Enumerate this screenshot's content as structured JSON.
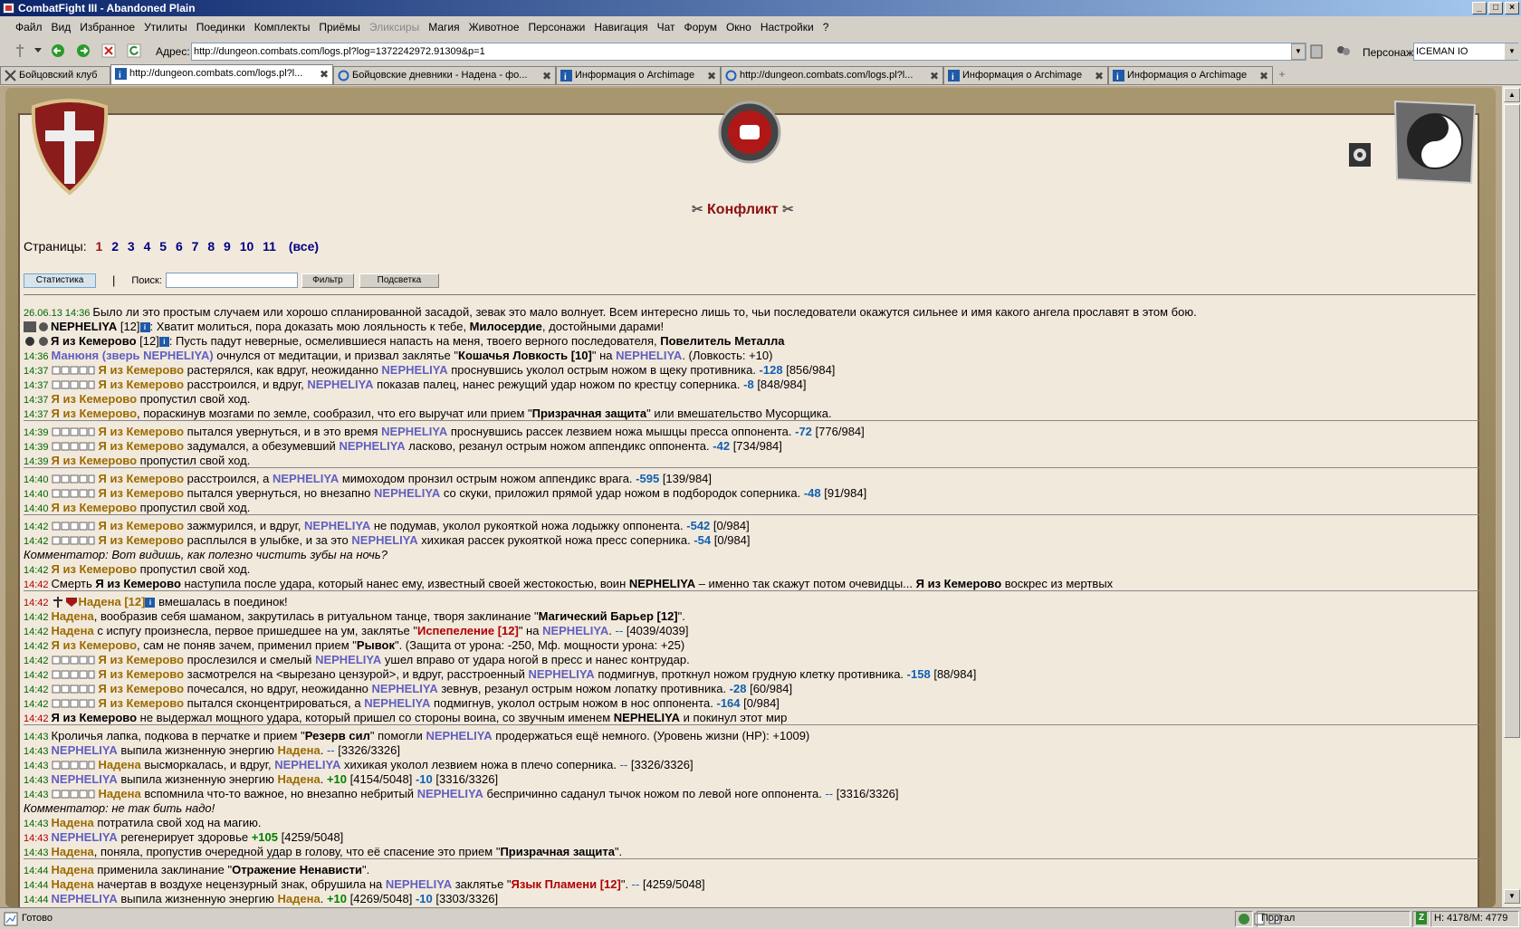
{
  "window": {
    "title": "CombatFight III - Abandoned Plain"
  },
  "menu": [
    "Файл",
    "Вид",
    "Избранное",
    "Утилиты",
    "Поединки",
    "Комплекты",
    "Приёмы",
    "Эликсиры",
    "Магия",
    "Животное",
    "Персонажи",
    "Навигация",
    "Чат",
    "Форум",
    "Окно",
    "Настройки",
    "?"
  ],
  "toolbar": {
    "address_label": "Адрес:",
    "address": "http://dungeon.combats.com/logs.pl?log=1372242972.91309&p=1",
    "persona_label": "Персонаж:",
    "persona": "ICEMAN IO"
  },
  "tabs": [
    "Бойцовский клуб",
    "http://dungeon.combats.com/logs.pl?l...",
    "Бойцовские дневники - Надена - фо...",
    "Информация о Archimage",
    "http://dungeon.combats.com/logs.pl?l...",
    "Информация о Archimage",
    "Информация о Archimage"
  ],
  "header": {
    "title": "Конфликт"
  },
  "pages": {
    "label": "Страницы:",
    "items": [
      "1",
      "2",
      "3",
      "4",
      "5",
      "6",
      "7",
      "8",
      "9",
      "10",
      "11"
    ],
    "all": "(все)"
  },
  "controls": {
    "stats": "Статистика",
    "sep": "|",
    "search_label": "Поиск:",
    "filter": "Фильтр",
    "highlight": "Подсветка"
  },
  "log": [
    "26.06.13 14:36",
    "Было ли это простым случаем или хорошо спланированной засадой, зевак это мало волнует. Всем интересно лишь то, чьи последователи окажутся сильнее и имя какого ангела прославят в этом бою.",
    "NEPHELIYA",
    "[12]",
    ": Хватит молиться, пора доказать мою лояльность к тебе, ",
    "Милосердие",
    ", достойными дарами!",
    "Я из Кемерово",
    ": Пусть падут неверные, осмелившиеся напасть на меня, твоего верного последователя, ",
    "Повелитель Металла",
    "14:36",
    "Манюня (зверь NEPHELIYA)",
    " очнулся от медитации, и призвал заклятье \"",
    "Кошачья Ловкость [10]",
    "\" на ",
    ". (Ловкость: +10)",
    "14:37",
    " растерялся, как вдруг, неожиданно ",
    " проснувшись уколол острым ножом в щеку противника. ",
    "-128",
    "[856/984]",
    " расстроился, и вдруг, ",
    " показав палец, нанес режущий удар ножом по крестцу соперника. ",
    "-8",
    "[848/984]",
    " пропустил свой ход.",
    ", пораскинув мозгами по земле, сообразил, что его выручат или прием \"",
    "Призрачная защита",
    "\" или вмешательство Мусорщика.",
    "14:39",
    " пытался увернуться, и в это время ",
    " проснувшись рассек лезвием ножа мышцы пресса оппонента. ",
    "-72",
    "[776/984]",
    " задумался, а обезумевший ",
    " ласково, резанул острым ножом аппендикс оппонента. ",
    "-42",
    "[734/984]",
    "14:40",
    " расстроился, а ",
    " мимоходом пронзил острым ножом аппендикс врага. ",
    "-595",
    "[139/984]",
    " пытался увернуться, но внезапно ",
    " со скуки, приложил прямой удар ножом в подбородок соперника. ",
    "-48",
    "[91/984]",
    "14:42",
    " зажмурился, и вдруг, ",
    " не подумав, уколол рукояткой ножа лодыжку оппонента. ",
    "-542",
    "[0/984]",
    " расплылся в улыбке, и за это ",
    " хихикая рассек рукояткой ножа пресс соперника. ",
    "-54",
    "Комментатор: Вот видишь, как полезно чистить зубы на ночь?",
    "Смерть ",
    " наступила после удара, который нанес ему, известный своей жестокостью, воин ",
    " – именно так скажут потом очевидцы... ",
    " воскрес из мертвых",
    "Надена",
    "Надена [12]",
    " вмешалась в поединок!",
    ", вообразив себя шаманом, закрутилась в ритуальном танце, творя заклинание \"",
    "Магический Барьер [12]",
    "\".",
    " с испугу произнесла, первое пришедшее на ум, заклятье \"",
    "Испепеление [12]",
    "--",
    "[4039/4039]",
    ", сам не поняв зачем, применил прием \"",
    "Рывок",
    "\". (Защита от урона: -250, Мф. мощности урона: +25)",
    " прослезился и смелый ",
    " ушел вправо от удара ногой в пресс и нанес контрудар.",
    " засмотрелся на <вырезано цензурой>, и вдруг, расстроенный ",
    " подмигнув, проткнул ножом грудную клетку противника. ",
    "-158",
    "[88/984]",
    " почесался, но вдруг, неожиданно ",
    " зевнув, резанул острым ножом лопатку противника. ",
    "-28",
    "[60/984]",
    " пытался сконцентрироваться, а ",
    " подмигнув, уколол острым ножом в нос оппонента. ",
    "-164",
    " не выдержал мощного удара, который пришел со стороны воина, со звучным именем ",
    " и покинул этот мир",
    "14:43",
    "Кроличья лапка, подкова в перчатке и прием \"",
    "Резерв сил",
    "\" помогли ",
    " продержаться ещё немного. (Уровень жизни (HP): +1009)",
    " выпила жизненную энергию ",
    "[3326/3326]",
    " высморкалась, и вдруг, ",
    " хихикая уколол лезвием ножа в плечо соперника. ",
    "+10",
    "[4154/5048]",
    "-10",
    "[3316/3326]",
    " вспомнила что-то важное, но внезапно небритый ",
    " беспричинно саданул тычок ножом по левой ноге оппонента. ",
    "Комментатор: не так бить надо!",
    " потратила свой ход на магию.",
    " регенерирует здоровье ",
    "+105",
    "[4259/5048]",
    ", поняла, пропустив очередной удар в голову, что её спасение это прием \"",
    "14:44",
    " применила заклинание \"",
    "Отражение Ненависти",
    " начертав в воздухе нецензурный знак, обрушила на ",
    " заклятье \"",
    "Язык Пламени [12]",
    "[4269/5048]",
    "[3303/3326]",
    "."
  ],
  "status": {
    "text": "Готово",
    "portal": "Портал",
    "memory": "Н: 4178/М: 4779"
  }
}
